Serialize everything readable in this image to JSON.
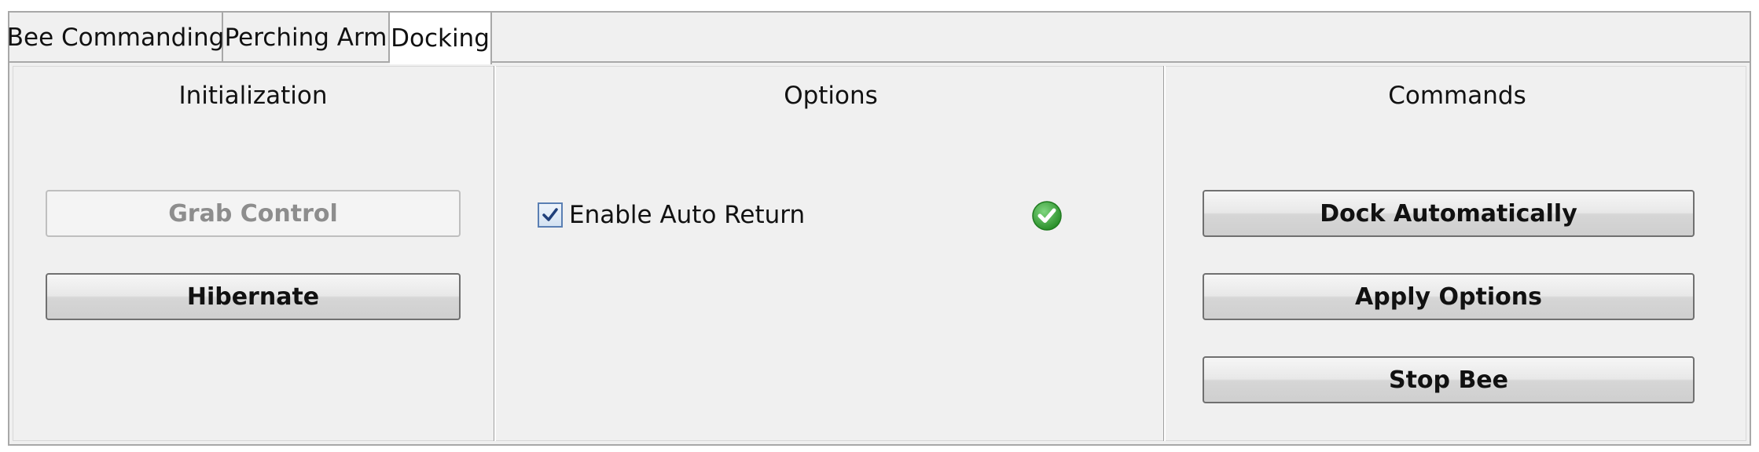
{
  "tabs": [
    {
      "label": "Bee Commanding",
      "active": false
    },
    {
      "label": "Perching Arm",
      "active": false
    },
    {
      "label": "Docking",
      "active": true
    }
  ],
  "initialization": {
    "title": "Initialization",
    "grab_control_label": "Grab Control",
    "grab_control_enabled": false,
    "hibernate_label": "Hibernate"
  },
  "options": {
    "title": "Options",
    "auto_return_label": "Enable Auto Return",
    "auto_return_checked": true,
    "status_icon": "check-circle-icon",
    "status_color": "#3aa33a"
  },
  "commands": {
    "title": "Commands",
    "dock_label": "Dock Automatically",
    "apply_label": "Apply Options",
    "stop_label": "Stop Bee"
  }
}
